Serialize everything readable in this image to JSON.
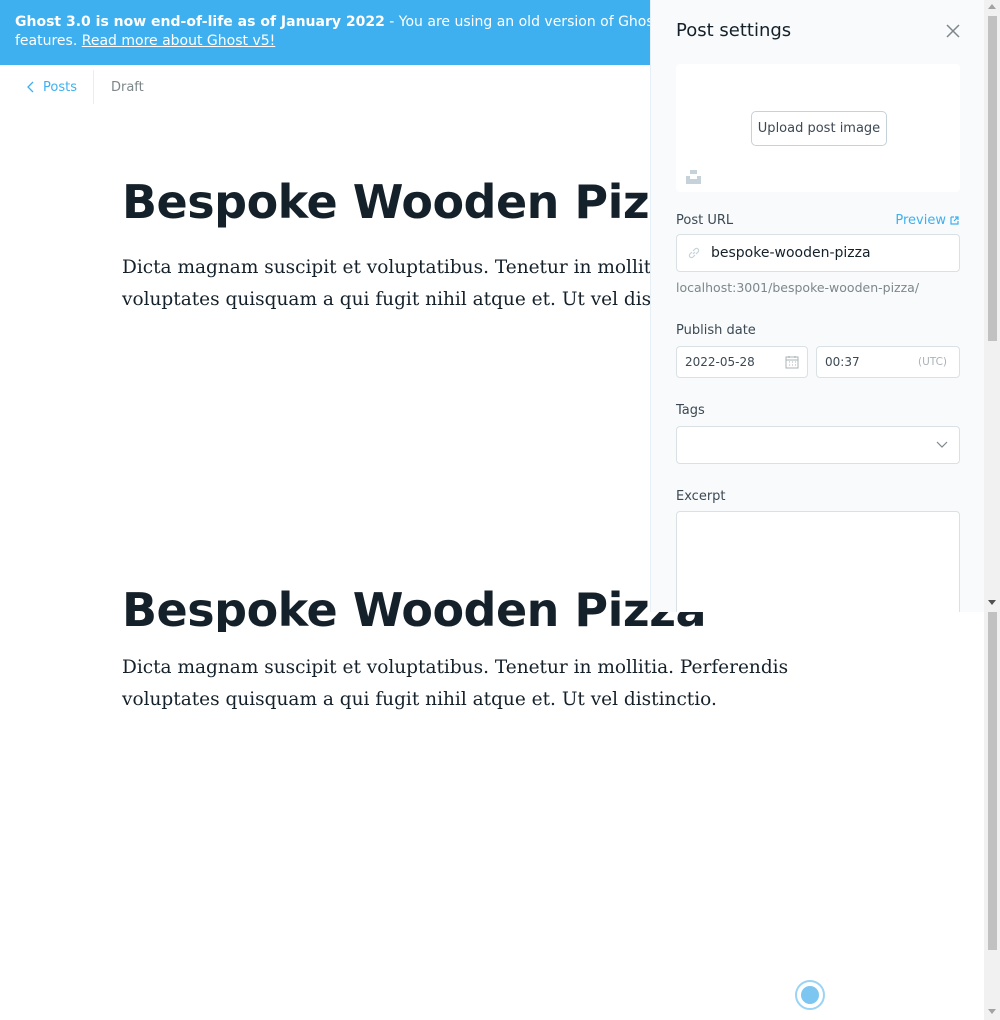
{
  "banner": {
    "bold_text": "Ghost 3.0 is now end-of-life as of January 2022",
    "text": " - You are using an old version of Ghost, which me",
    "line2_text": "features. ",
    "link_text": "Read more about Ghost v5!"
  },
  "editor_header": {
    "back_label": "Posts",
    "status": "Draft"
  },
  "post": {
    "title": "Bespoke Wooden Pizza",
    "body": "Dicta magnam suscipit et voluptatibus. Tenetur in mollitia. Perferendis voluptates quisquam a qui fugit nihil atque et. Ut vel distinctio."
  },
  "settings": {
    "title": "Post settings",
    "upload_label": "Upload post image",
    "post_url_label": "Post URL",
    "preview_label": "Preview",
    "slug": "bespoke-wooden-pizza",
    "url_preview": "localhost:3001/bespoke-wooden-pizza/",
    "publish_date_label": "Publish date",
    "date": "2022-05-28",
    "time": "00:37",
    "timezone": "(UTC)",
    "tags_label": "Tags",
    "excerpt_label": "Excerpt"
  },
  "colors": {
    "accent": "#3eb0ef",
    "text": "#15212a",
    "muted": "#7d878a"
  }
}
